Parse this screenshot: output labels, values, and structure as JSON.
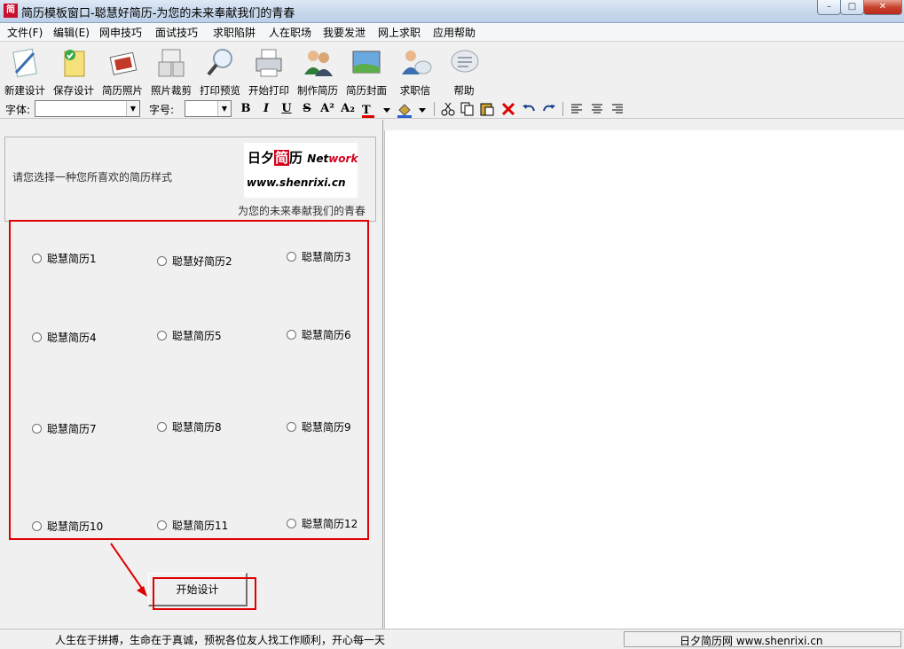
{
  "window": {
    "title": "简历模板窗口-聪慧好简历-为您的未来奉献我们的青春",
    "app_icon_glyph": "简",
    "minimize_glyph": "–",
    "maximize_glyph": "□",
    "close_glyph": "✕"
  },
  "menu": [
    "文件(F)",
    "编辑(E)",
    "网申技巧",
    "面试技巧",
    "求职陷阱",
    "人在职场",
    "我要发泄",
    "网上求职",
    "应用帮助"
  ],
  "toolbar": {
    "new_design": "新建设计",
    "save_design": "保存设计",
    "resume_photo": "简历照片",
    "photo_crop": "照片裁剪",
    "print_preview": "打印预览",
    "start_print": "开始打印",
    "make_resume": "制作简历",
    "resume_cover": "简历封面",
    "cover_letter": "求职信",
    "help": "帮助"
  },
  "format_bar": {
    "font_label": "字体:",
    "font_value": "",
    "size_label": "字号:",
    "size_value": "",
    "bold": "B",
    "italic": "I",
    "underline": "U",
    "strike": "S",
    "superscript": "A²",
    "subscript": "A₂"
  },
  "banner": {
    "prompt": "请您选择一种您所喜欢的简历样式",
    "logo_text_1": "日夕",
    "logo_text_jian": "简",
    "logo_text_2": "历",
    "logo_net": "Net",
    "logo_work": "work",
    "logo_url": "www.shenrixi.cn",
    "slogan": "为您的未来奉献我们的青春"
  },
  "options": [
    "聪慧简历1",
    "聪慧好简历2",
    "聪慧简历3",
    "聪慧简历4",
    "聪慧简历5",
    "聪慧简历6",
    "聪慧简历7",
    "聪慧简历8",
    "聪慧简历9",
    "聪慧简历10",
    "聪慧简历11",
    "聪慧简历12"
  ],
  "start_button": "开始设计",
  "status": {
    "left": "人生在于拼搏，生命在于真诚，预祝各位友人找工作顺利，开心每一天",
    "right": "日夕简历网 www.shenrixi.cn"
  },
  "colors": {
    "highlight": "#e00000",
    "logo_red": "#d0021b"
  }
}
